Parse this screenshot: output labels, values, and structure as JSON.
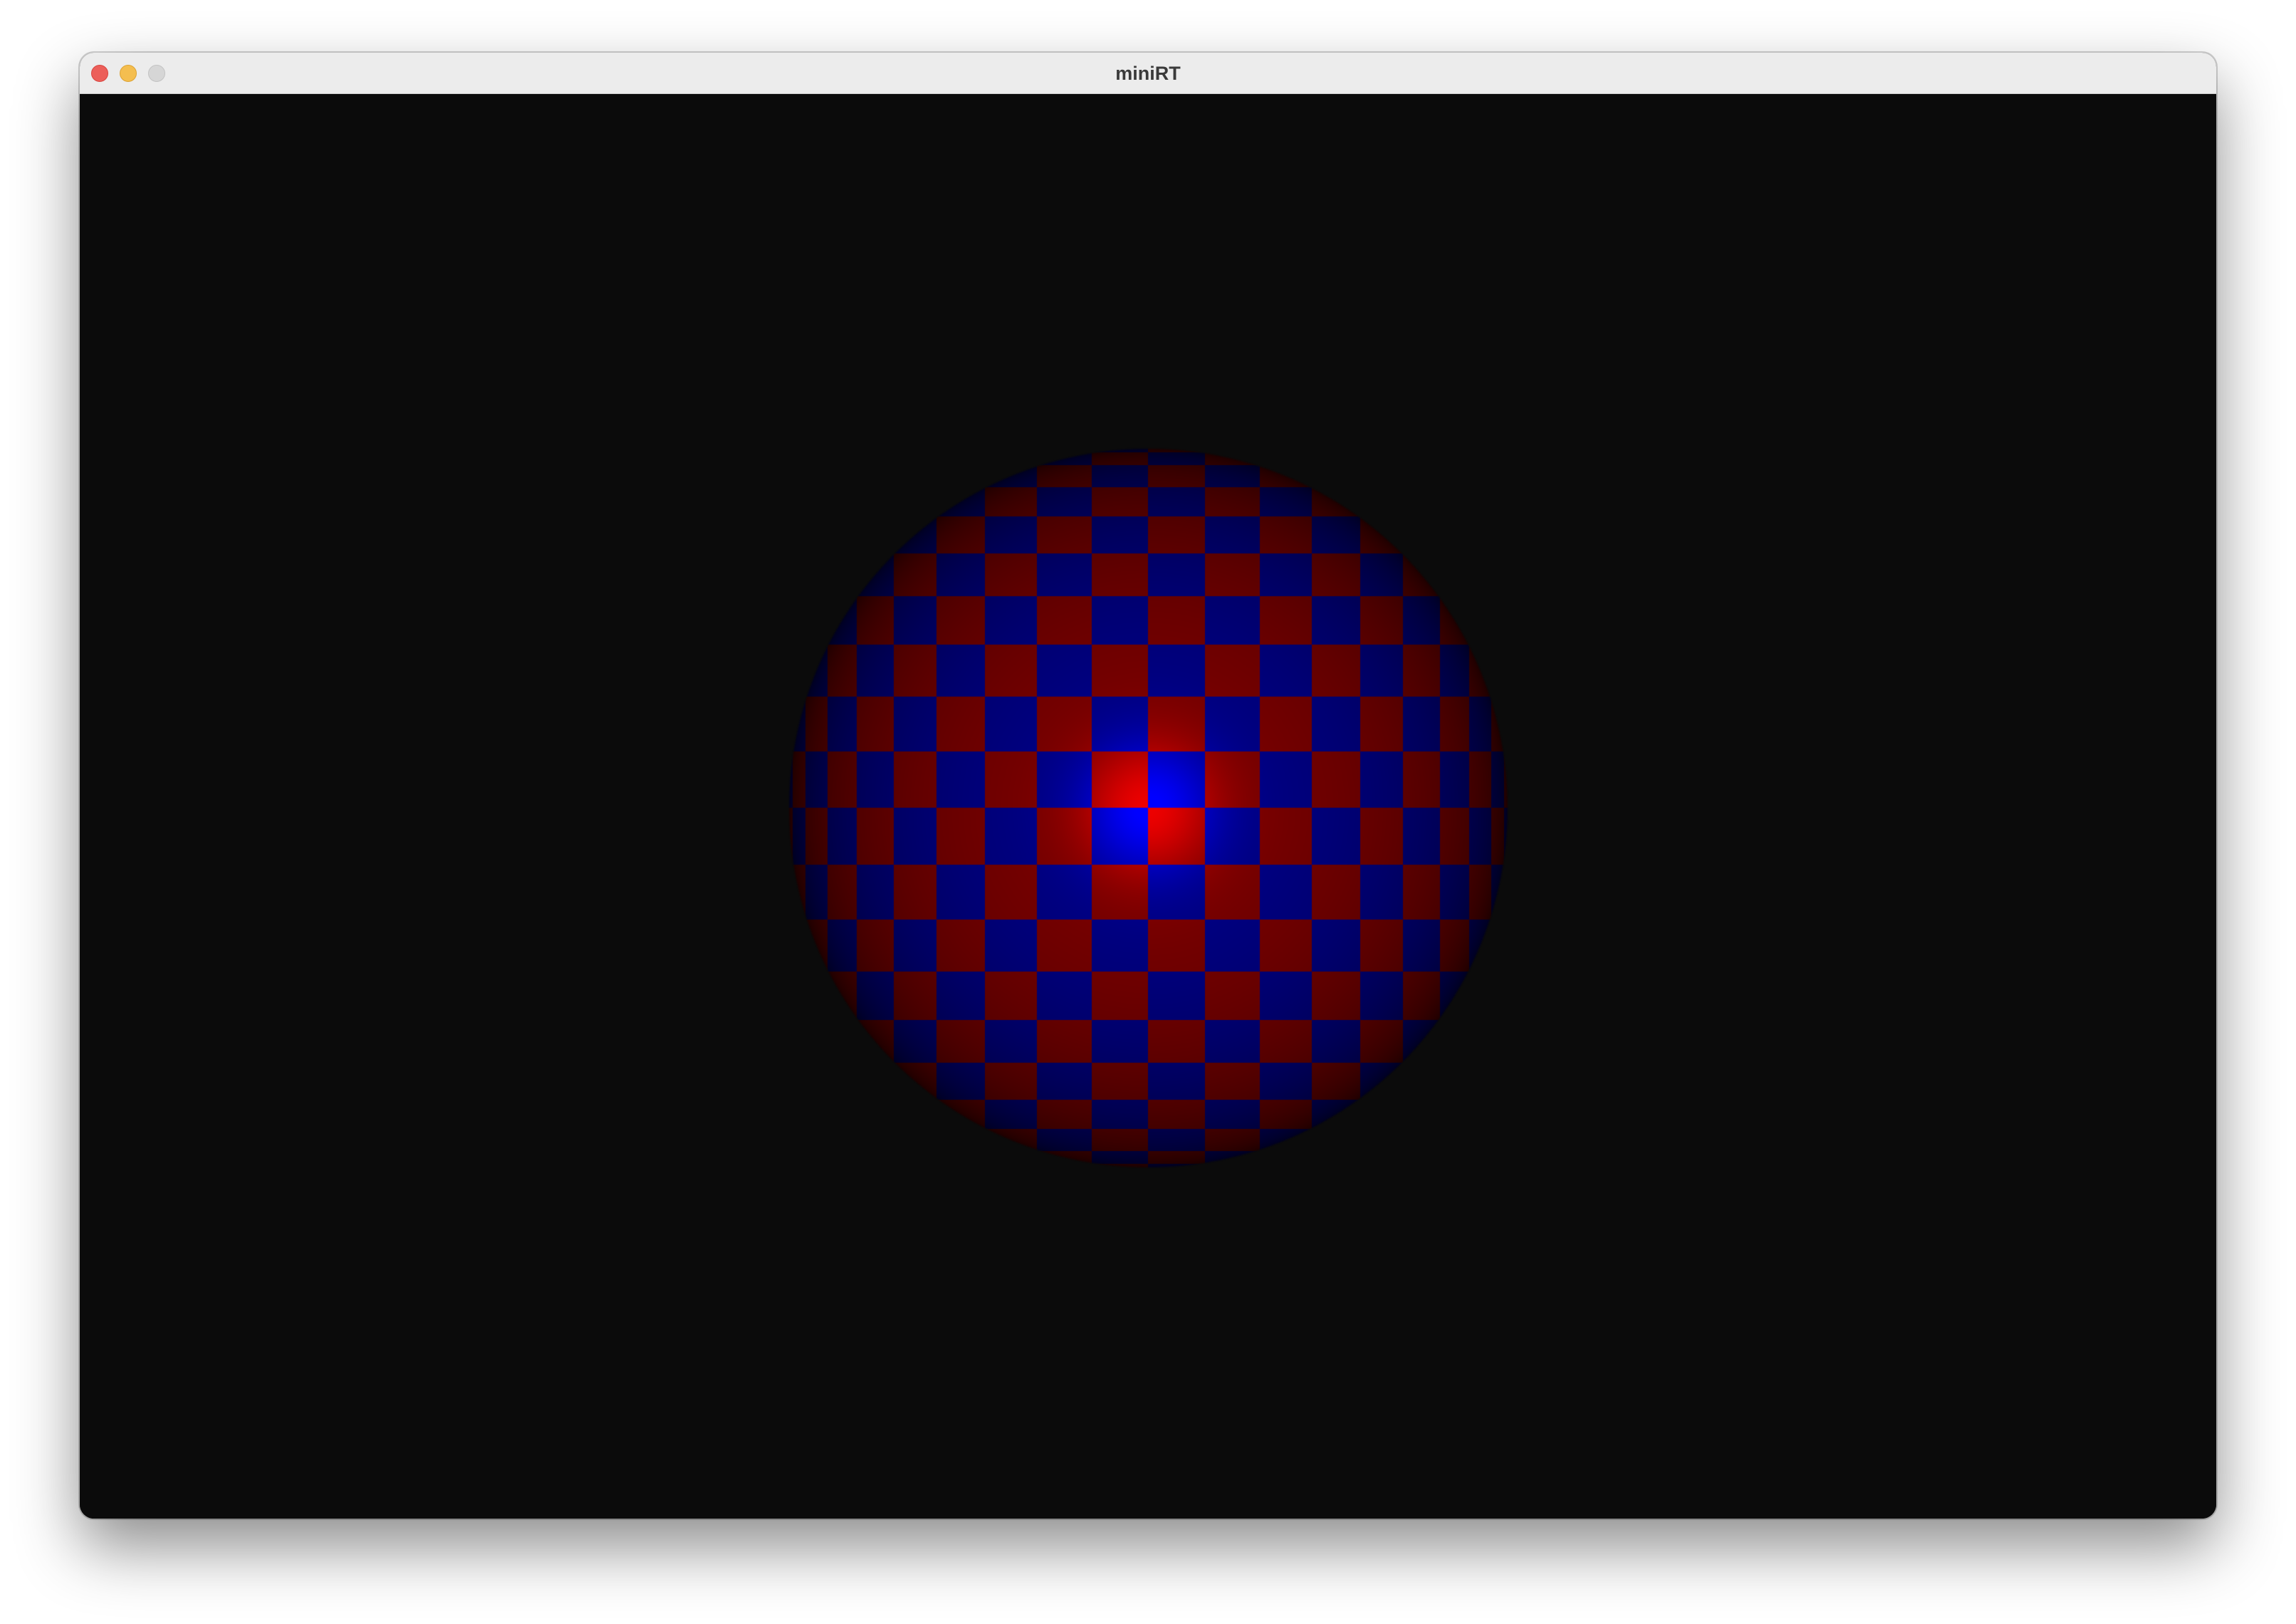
{
  "window": {
    "title": "miniRT"
  },
  "scene": {
    "object": "sphere",
    "texture": "checkerboard",
    "background_color": "#0b0b0b",
    "checker_colors": [
      "#d20000",
      "#0000e6"
    ]
  }
}
